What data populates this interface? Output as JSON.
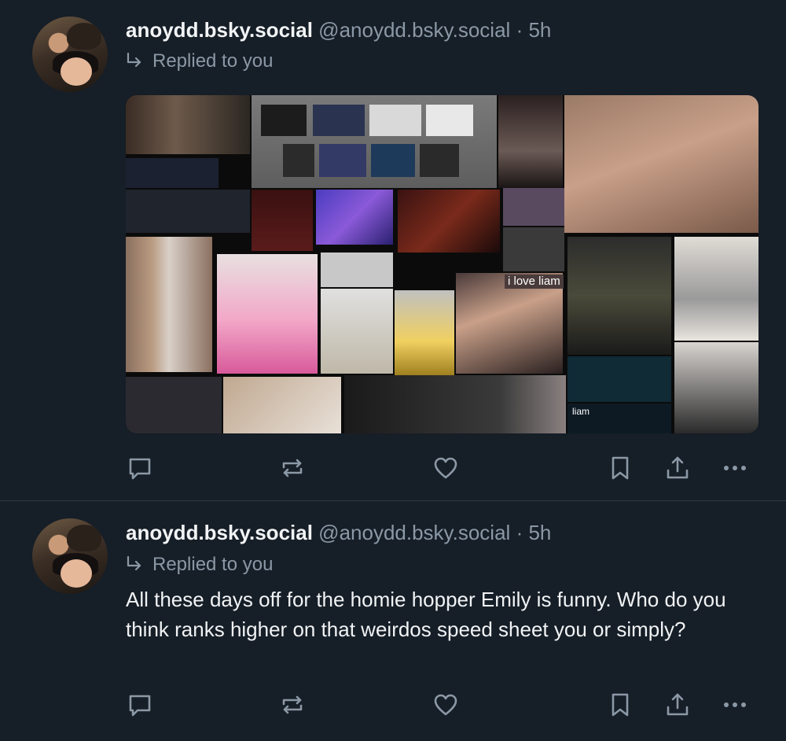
{
  "colors": {
    "background": "#161e27",
    "text_primary": "#f1f3f5",
    "text_secondary": "#8b98a6",
    "divider": "#2e3843"
  },
  "posts": [
    {
      "author_name": "anoydd.bsky.social",
      "author_handle": "@anoydd.bsky.social",
      "separator": "·",
      "time": "5h",
      "reply_label": "Replied to you",
      "reply_icon": "reply-arrow-icon",
      "image_caption": "i love liam",
      "image_profile_name": "liam",
      "actions": [
        "reply-icon",
        "repost-icon",
        "like-icon",
        "bookmark-icon",
        "share-icon",
        "more-icon"
      ]
    },
    {
      "author_name": "anoydd.bsky.social",
      "author_handle": "@anoydd.bsky.social",
      "separator": "·",
      "time": "5h",
      "reply_label": "Replied to you",
      "reply_icon": "reply-arrow-icon",
      "text": "All these days off for the homie hopper Emily is funny. Who do you think ranks higher on that weirdos speed sheet you or simply?",
      "actions": [
        "reply-icon",
        "repost-icon",
        "like-icon",
        "bookmark-icon",
        "share-icon",
        "more-icon"
      ]
    }
  ]
}
